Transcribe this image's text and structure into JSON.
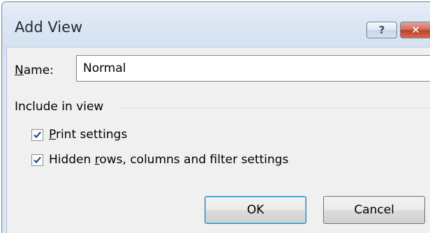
{
  "window": {
    "title": "Add View",
    "help_glyph": "?",
    "close_glyph": "✕"
  },
  "name_field": {
    "label_first": "N",
    "label_rest": "ame:",
    "value": "Normal"
  },
  "include_group": {
    "label": "Include in view",
    "options": [
      {
        "prefix": "",
        "accel": "P",
        "rest": "rint settings",
        "checked": true
      },
      {
        "prefix": "Hidden ",
        "accel": "r",
        "rest": "ows, columns and filter settings",
        "checked": true
      }
    ]
  },
  "buttons": {
    "ok": "OK",
    "cancel": "Cancel"
  }
}
